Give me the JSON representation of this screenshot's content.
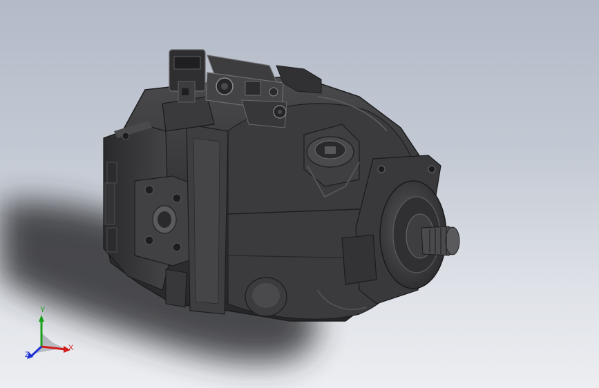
{
  "viewport": {
    "background_top": "#b3bac8",
    "background_bottom": "#eceef1",
    "model_color": "#3a3a3a"
  },
  "triad": {
    "x_label": "X",
    "y_label": "Y",
    "z_label": "Z",
    "x_color": "#d21c1c",
    "y_color": "#1aa01a",
    "z_color": "#1c2fd2"
  }
}
